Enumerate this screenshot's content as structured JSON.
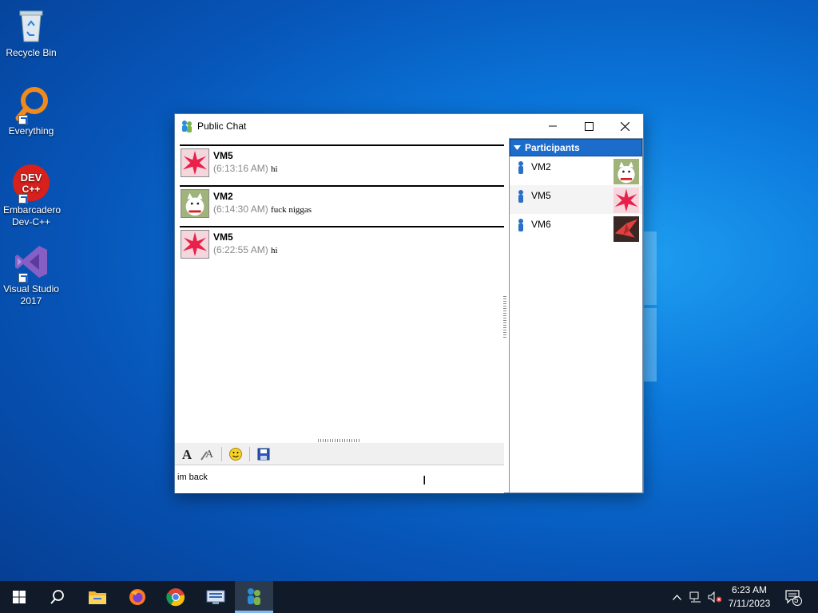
{
  "desktop": {
    "icons": [
      {
        "label": "Recycle Bin",
        "icon": "recycle-bin-icon"
      },
      {
        "label": "Everything",
        "icon": "everything-search-icon"
      },
      {
        "label": "Embarcadero Dev-C++",
        "icon": "devcpp-icon",
        "logo_text": "DEV C++"
      },
      {
        "label": "Visual Studio 2017",
        "icon": "visual-studio-icon"
      }
    ]
  },
  "window": {
    "title": "Public Chat",
    "controls": {
      "minimize": "—",
      "maximize": "☐",
      "close": "✕"
    },
    "messages": [
      {
        "author": "VM5",
        "time": "(6:13:16 AM)",
        "text": "hi",
        "avatar": "red-star-avatar"
      },
      {
        "author": "VM2",
        "time": "(6:14:30 AM)",
        "text": "fuck niggas",
        "avatar": "lucky-cat-avatar"
      },
      {
        "author": "VM5",
        "time": "(6:22:55 AM)",
        "text": "hi",
        "avatar": "red-star-avatar"
      }
    ],
    "toolbar": {
      "font": "font-icon",
      "font_color": "font-color-icon",
      "emoticon": "smiley-icon",
      "save": "save-icon"
    },
    "input": {
      "value": "im back"
    },
    "participants": {
      "header": "Participants",
      "items": [
        {
          "name": "VM2",
          "avatar": "lucky-cat-avatar"
        },
        {
          "name": "VM5",
          "avatar": "red-star-avatar"
        },
        {
          "name": "VM6",
          "avatar": "origami-crane-avatar"
        }
      ]
    }
  },
  "taskbar": {
    "apps": [
      "start-icon",
      "search-icon",
      "file-explorer-icon",
      "firefox-icon",
      "chrome-icon",
      "network-app-icon",
      "chat-app-icon"
    ],
    "clock": {
      "time": "6:23 AM",
      "date": "7/11/2023"
    },
    "notifications_count": "5"
  },
  "colors": {
    "accent": "#1c6ccc",
    "taskbar": "#101a28",
    "desktop": "#0b78dc"
  }
}
